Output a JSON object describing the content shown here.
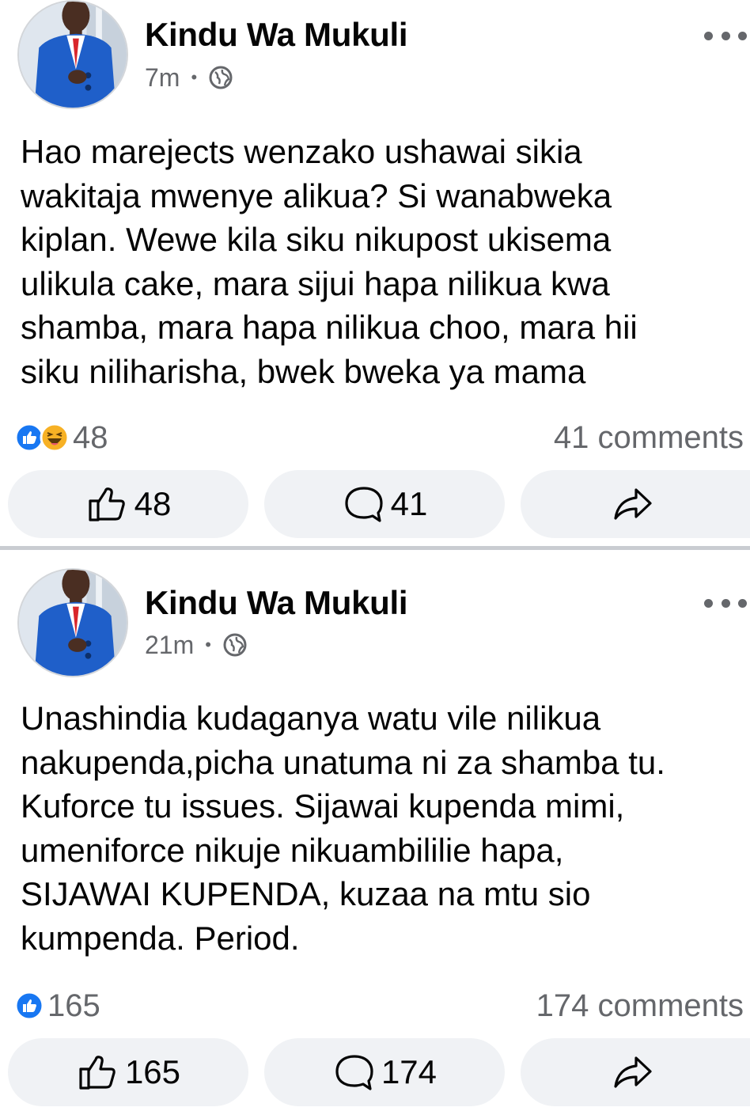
{
  "posts": [
    {
      "author": "Kindu Wa Mukuli",
      "time": "7m",
      "separator": "•",
      "text": "Hao marejects wenzako ushawai sikia\nwakitaja mwenye alikua? Si wanabweka\nkiplan. Wewe kila siku nikupost ukisema\nulikula cake, mara sijui hapa nilikua kwa\nshamba, mara hapa nilikua choo, mara hii\nsiku niliharisha, bwek bweka ya mama",
      "reactions": {
        "icons": [
          "like-icon",
          "haha-icon"
        ],
        "count": "48"
      },
      "comments_summary": "41 comments",
      "actions": {
        "like": "48",
        "comment": "41"
      }
    },
    {
      "author": "Kindu Wa Mukuli",
      "time": "21m",
      "separator": "•",
      "text": "Unashindia kudaganya watu vile nilikua\nnakupenda,picha unatuma ni za shamba tu.\nKuforce tu issues. Sijawai kupenda mimi,\numeniforce nikuje nikuambililie hapa,\nSIJAWAI KUPENDA, kuzaa na mtu sio\nkumpenda. Period.",
      "reactions": {
        "icons": [
          "like-icon"
        ],
        "count": "165"
      },
      "comments_summary": "174 comments",
      "actions": {
        "like": "165",
        "comment": "174"
      }
    }
  ],
  "colors": {
    "like_blue": "#1877f2",
    "haha_yellow": "#f7b125",
    "muted_text": "#65676b",
    "button_bg": "#f0f2f5",
    "suit_blue": "#1f5fc9",
    "tie_red": "#d9262b"
  }
}
